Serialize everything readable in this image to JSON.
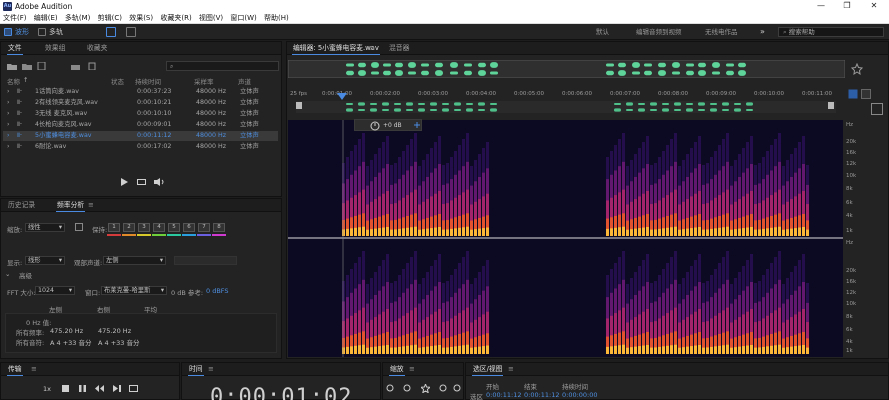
{
  "window": {
    "title": "Adobe Audition",
    "app_icon_text": "Au",
    "min": "—",
    "max": "❐",
    "close": "✕"
  },
  "menu": [
    "文件(F)",
    "编辑(E)",
    "多轨(M)",
    "剪辑(C)",
    "效果(S)",
    "收藏夹(R)",
    "视图(V)",
    "窗口(W)",
    "帮助(H)"
  ],
  "toolbar": {
    "waveform": "波形",
    "multitrack": "多轨",
    "workspaces": [
      "默认",
      "编辑音频到视频",
      "无线电作品"
    ],
    "more": "»",
    "search_placeholder": "搜索帮助"
  },
  "files_panel": {
    "tabs": [
      "文件",
      "效果组",
      "收藏夹"
    ],
    "columns": [
      "名称",
      "状态",
      "持续时间",
      "采样率",
      "声道"
    ],
    "sort_arrow": "↑",
    "rows": [
      {
        "name": "1话筒向麦.wav",
        "duration": "0:00:37:23",
        "rate": "48000 Hz",
        "channels": "立体声",
        "selected": false
      },
      {
        "name": "2有线领夹麦克风.wav",
        "duration": "0:00:10:21",
        "rate": "48000 Hz",
        "channels": "立体声",
        "selected": false
      },
      {
        "name": "3无线 麦克风.wav",
        "duration": "0:00:10:10",
        "rate": "48000 Hz",
        "channels": "立体声",
        "selected": false
      },
      {
        "name": "4长枪向麦克风.wav",
        "duration": "0:00:09:01",
        "rate": "48000 Hz",
        "channels": "立体声",
        "selected": false
      },
      {
        "name": "5小蜜蜂电容麦.wav",
        "duration": "0:00:11:12",
        "rate": "48000 Hz",
        "channels": "立体声",
        "selected": true
      },
      {
        "name": "6耐论.wav",
        "duration": "0:00:17:02",
        "rate": "48000 Hz",
        "channels": "立体声",
        "selected": false
      }
    ]
  },
  "freq_panel": {
    "tabs": [
      "历史记录",
      "频率分析"
    ],
    "scale_label": "缩放:",
    "scale_value": "线性",
    "hold_label": "保持:",
    "hold_channels": [
      "1",
      "2",
      "3",
      "4",
      "5",
      "6",
      "7",
      "8"
    ],
    "hold_colors": [
      "#d63b3b",
      "#e08a2a",
      "#d8c92a",
      "#6fcf3a",
      "#2ac9a0",
      "#2a9fe0",
      "#6a5fe0",
      "#d03ad0"
    ],
    "display_label": "显示:",
    "display_value": "线形",
    "channel_label": "观部声道:",
    "channel_value": "左侧",
    "section_advanced": "高级",
    "fft_label": "FFT 大小:",
    "fft_value": "1024",
    "window_label": "窗口:",
    "window_value": "布莱克曼-哈里斯",
    "ref_label": "0 dB 参考:",
    "ref_value": "0 dBFS",
    "col_left": "左侧",
    "col_right": "右侧",
    "col_avg": "平均",
    "hz0_label": "0 Hz 值:",
    "all_freq_label": "所有频率:",
    "all_pitch_label": "所有音符:",
    "all_freq_left": "475.20 Hz",
    "all_freq_right": "475.20 Hz",
    "all_pitch_left": "A 4 +33 音分",
    "all_pitch_right": "A 4 +33 音分"
  },
  "editor": {
    "tab_label": "编辑器: 5小蜜蜂电容麦.wav",
    "mixer_tab": "混音器",
    "fps": "25 fps",
    "ruler": [
      "0:00:01:00",
      "0:00:02:00",
      "0:00:03:00",
      "0:00:04:00",
      "0:00:05:00",
      "0:00:06:00",
      "0:00:07:00",
      "0:00:08:00",
      "0:00:09:00",
      "0:00:10:00",
      "0:00:11:00"
    ],
    "gain": "+0 dB",
    "hz_top": "Hz",
    "freq_labels_top": [
      "20k",
      "16k",
      "12k",
      "10k",
      "8k",
      "6k",
      "4k",
      "1k"
    ],
    "freq_labels_bottom": [
      "20k",
      "16k",
      "12k",
      "10k",
      "8k",
      "6k",
      "4k",
      "1k"
    ],
    "hz_bottom": "Hz"
  },
  "transport": {
    "tab": "传输",
    "rate": "1x"
  },
  "time_panel": {
    "tab": "时间",
    "time": "0:00:01:02"
  },
  "zoom_panel": {
    "tab": "缩放"
  },
  "selection_panel": {
    "tab": "选区/视图",
    "col_start": "开始",
    "col_end": "结束",
    "col_duration": "持续时间",
    "row_label": "选区",
    "start": "0:00:11:12",
    "end": "0:00:11:12",
    "duration": "0:00:00:00"
  }
}
